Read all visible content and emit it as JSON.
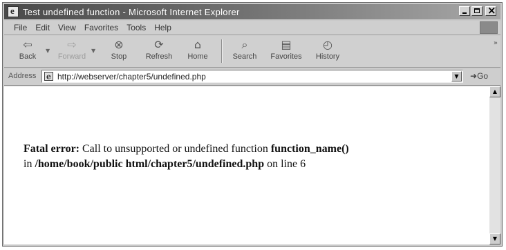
{
  "window": {
    "title": "Test undefined function - Microsoft Internet Explorer",
    "controls": [
      "minimize-icon",
      "maximize-icon",
      "close-icon"
    ]
  },
  "menu": {
    "items": [
      "File",
      "Edit",
      "View",
      "Favorites",
      "Tools",
      "Help"
    ]
  },
  "toolbar": {
    "back": {
      "label": "Back",
      "icon": "back-arrow-icon"
    },
    "forward": {
      "label": "Forward",
      "icon": "forward-arrow-icon",
      "disabled": true
    },
    "stop": {
      "label": "Stop",
      "icon": "stop-icon"
    },
    "refresh": {
      "label": "Refresh",
      "icon": "refresh-icon"
    },
    "home": {
      "label": "Home",
      "icon": "home-icon"
    },
    "search": {
      "label": "Search",
      "icon": "search-icon"
    },
    "favorites": {
      "label": "Favorites",
      "icon": "favorites-icon"
    },
    "history": {
      "label": "History",
      "icon": "history-icon"
    }
  },
  "address": {
    "label": "Address",
    "url": "http://webserver/chapter5/undefined.php",
    "go_label": "Go"
  },
  "page": {
    "error_word1": "Fatal",
    "error_word2": "error:",
    "message_text": "Call to unsupported or undefined function",
    "function_name": "function_name()",
    "in_word": "in",
    "file_path": "/home/book/public html/chapter5/undefined.php",
    "line_text": "on line",
    "line_number": "6"
  }
}
